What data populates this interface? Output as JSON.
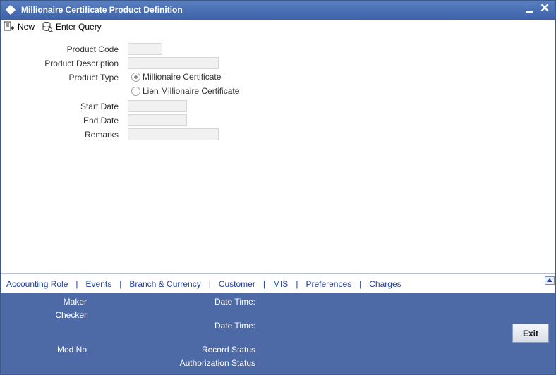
{
  "window": {
    "title": "Millionaire Certificate Product Definition"
  },
  "toolbar": {
    "new_label": "New",
    "enter_query_label": "Enter Query"
  },
  "form": {
    "product_code_label": "Product Code",
    "product_code_value": "",
    "product_description_label": "Product Description",
    "product_description_value": "",
    "product_type_label": "Product Type",
    "product_type_options": [
      {
        "label": "Millionaire Certificate",
        "selected": true
      },
      {
        "label": "Lien Millionaire Certificate",
        "selected": false
      }
    ],
    "start_date_label": "Start Date",
    "start_date_value": "",
    "end_date_label": "End Date",
    "end_date_value": "",
    "remarks_label": "Remarks",
    "remarks_value": ""
  },
  "tabs": [
    "Accounting Role",
    "Events",
    "Branch & Currency",
    "Customer",
    "MIS",
    "Preferences",
    "Charges"
  ],
  "tab_separator": "|",
  "footer": {
    "maker_label": "Maker",
    "checker_label": "Checker",
    "date_time_label_1": "Date Time:",
    "date_time_label_2": "Date Time:",
    "mod_no_label": "Mod No",
    "record_status_label": "Record Status",
    "authorization_status_label": "Authorization Status",
    "exit_label": "Exit"
  },
  "colors": {
    "titlebar": "#4a6fb3",
    "footer": "#4d6aa6",
    "link": "#1f3fa0"
  }
}
